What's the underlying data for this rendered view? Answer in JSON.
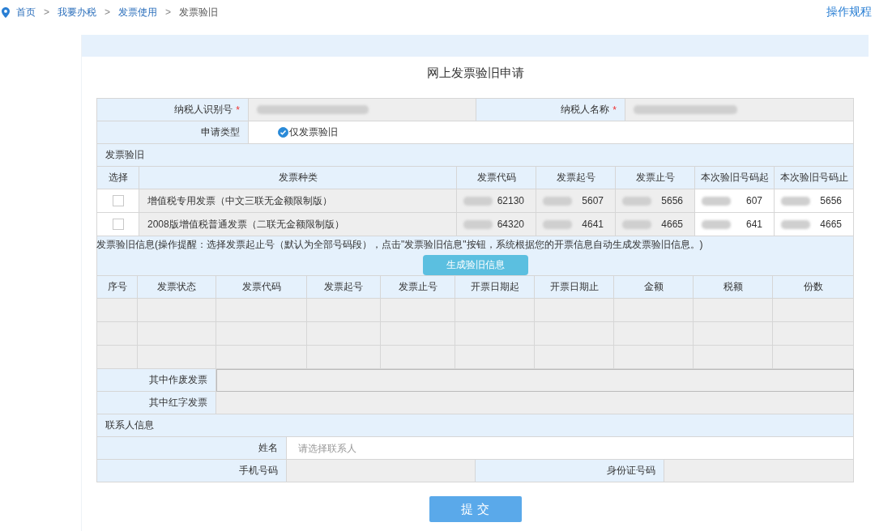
{
  "breadcrumb": [
    {
      "label": "首页",
      "link": true
    },
    {
      "label": "我要办税",
      "link": true
    },
    {
      "label": "发票使用",
      "link": true
    },
    {
      "label": "发票验旧",
      "link": false
    }
  ],
  "breadcrumb_separator": ">",
  "help_link": "操作规程",
  "title": "网上发票验旧申请",
  "taxpayer": {
    "id_label": "纳税人识别号",
    "name_label": "纳税人名称",
    "required_mark": "*"
  },
  "application_type": {
    "label": "申请类型",
    "option": "仅发票验旧",
    "checked": true
  },
  "invoice_section": {
    "title": "发票验旧",
    "columns": [
      "选择",
      "发票种类",
      "发票代码",
      "发票起号",
      "发票止号",
      "本次验旧号码起",
      "本次验旧号码止"
    ],
    "rows": [
      {
        "checked": false,
        "type": "增值税专用发票（中文三联无金额限制版）",
        "code": "62130",
        "start": "5607",
        "end": "5656",
        "check_start": "607",
        "check_end": "5656"
      },
      {
        "checked": false,
        "type": "2008版增值税普通发票（二联无金额限制版）",
        "code": "64320",
        "start": "4641",
        "end": "4665",
        "check_start": "641",
        "check_end": "4665"
      }
    ]
  },
  "info_section": {
    "note": "发票验旧信息(操作提醒：选择发票起止号（默认为全部号码段），点击\"发票验旧信息\"按钮，系统根据您的开票信息自动生成发票验旧信息。)",
    "button": "生成验旧信息",
    "columns": [
      "序号",
      "发票状态",
      "发票代码",
      "发票起号",
      "发票止号",
      "开票日期起",
      "开票日期止",
      "金额",
      "税额",
      "份数"
    ],
    "void_label": "其中作废发票",
    "red_label": "其中红字发票"
  },
  "contact": {
    "title": "联系人信息",
    "name_label": "姓名",
    "name_placeholder": "请选择联系人",
    "phone_label": "手机号码",
    "id_label": "身份证号码"
  },
  "submit": "提 交"
}
